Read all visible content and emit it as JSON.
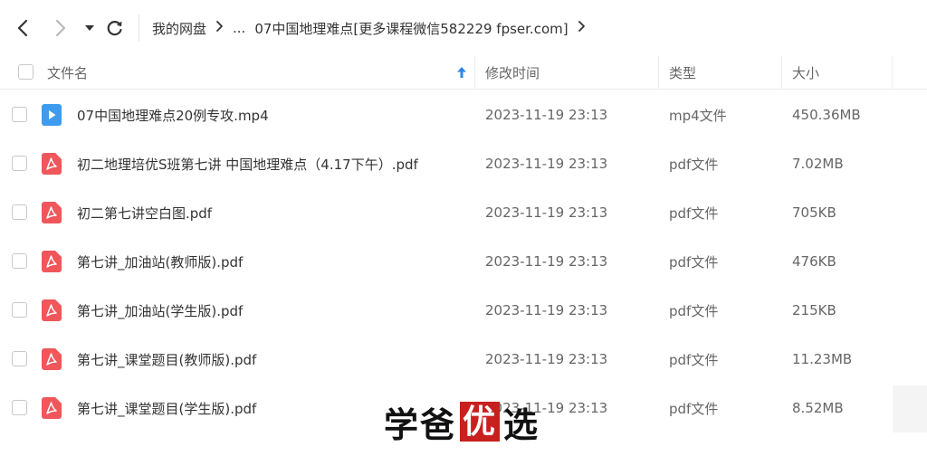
{
  "breadcrumb": {
    "root": "我的网盘",
    "ellipsis": "...",
    "current": "07中国地理难点[更多课程微信582229 fpser.com]"
  },
  "columns": {
    "name": "文件名",
    "modified": "修改时间",
    "type": "类型",
    "size": "大小"
  },
  "files": [
    {
      "name": "07中国地理难点20例专攻.mp4",
      "modified": "2023-11-19 23:13",
      "type": "mp4文件",
      "size": "450.36MB",
      "icon": "video-file-icon"
    },
    {
      "name": "初二地理培优S班第七讲 中国地理难点（4.17下午）.pdf",
      "modified": "2023-11-19 23:13",
      "type": "pdf文件",
      "size": "7.02MB",
      "icon": "pdf-file-icon"
    },
    {
      "name": "初二第七讲空白图.pdf",
      "modified": "2023-11-19 23:13",
      "type": "pdf文件",
      "size": "705KB",
      "icon": "pdf-file-icon"
    },
    {
      "name": "第七讲_加油站(教师版).pdf",
      "modified": "2023-11-19 23:13",
      "type": "pdf文件",
      "size": "476KB",
      "icon": "pdf-file-icon"
    },
    {
      "name": "第七讲_加油站(学生版).pdf",
      "modified": "2023-11-19 23:13",
      "type": "pdf文件",
      "size": "215KB",
      "icon": "pdf-file-icon"
    },
    {
      "name": "第七讲_课堂题目(教师版).pdf",
      "modified": "2023-11-19 23:13",
      "type": "pdf文件",
      "size": "11.23MB",
      "icon": "pdf-file-icon"
    },
    {
      "name": "第七讲_课堂题目(学生版).pdf",
      "modified": "2023-11-19 23:13",
      "type": "pdf文件",
      "size": "8.52MB",
      "icon": "pdf-file-icon"
    }
  ],
  "watermark": {
    "part1": "学爸",
    "seal": "优",
    "part2": "选"
  },
  "colors": {
    "pdf": "#f0565a",
    "video": "#3d9cf0",
    "accent": "#2f86e8"
  }
}
